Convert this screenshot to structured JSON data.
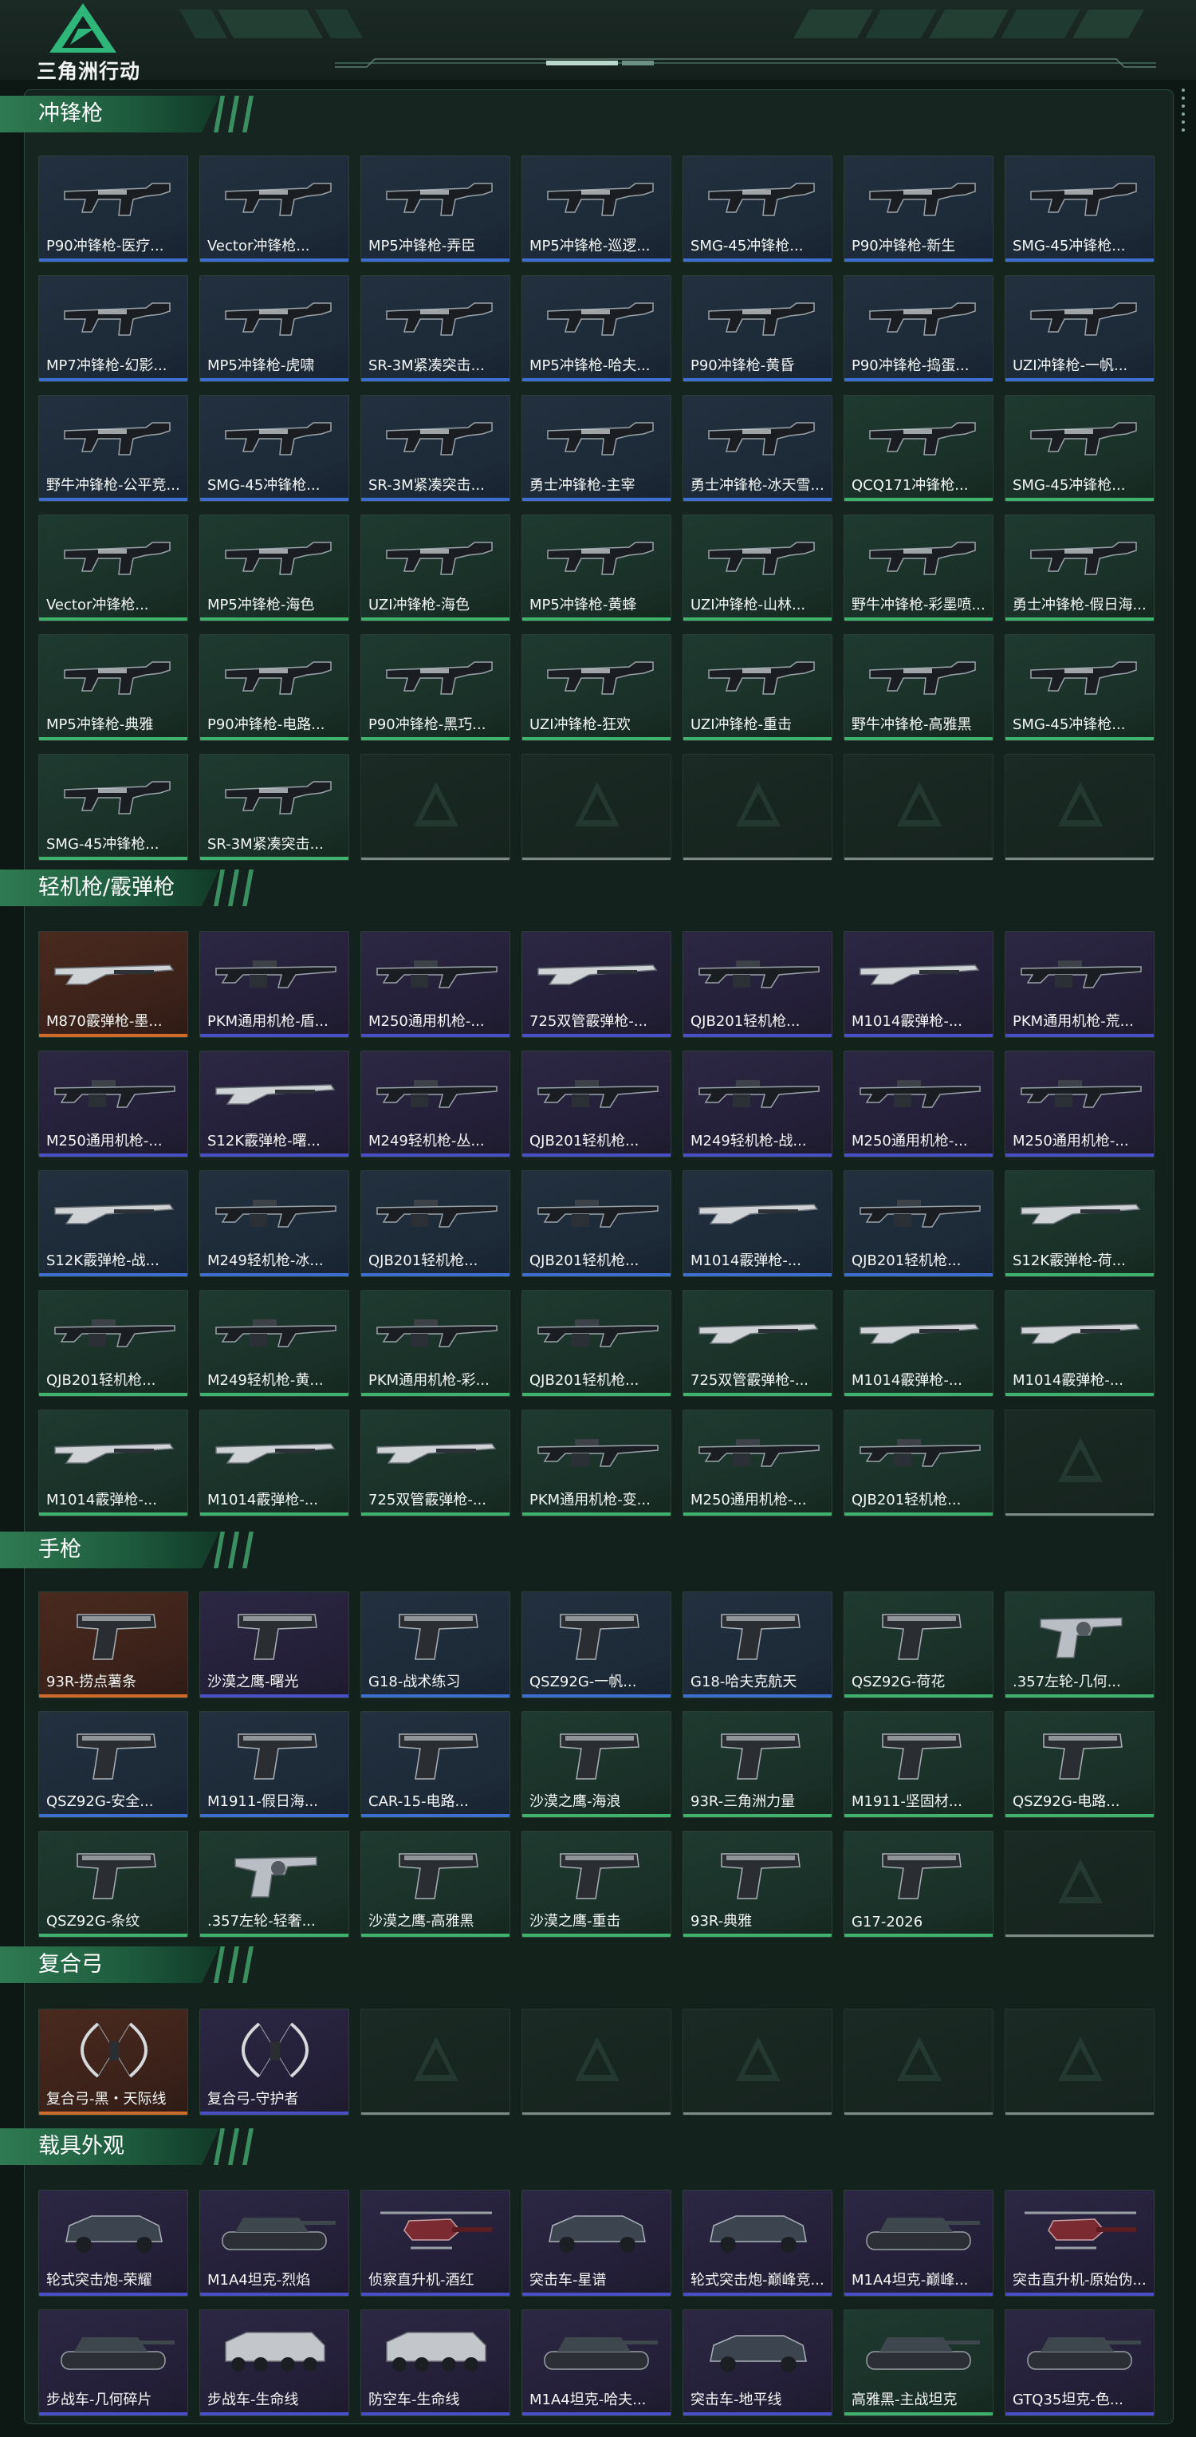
{
  "header": {
    "logo_text": "三角洲行动"
  },
  "colors": {
    "purple": "#4a4fc8",
    "blue": "#3c6fd0",
    "green": "#3fb36e",
    "orange": "#d06a2a",
    "empty": "#7d8a85"
  },
  "sections": [
    {
      "title": "冲锋枪",
      "items": [
        {
          "name": "P90冲锋枪-医疗...",
          "rarity": "blue",
          "icon": "smg-icon"
        },
        {
          "name": "Vector冲锋枪...",
          "rarity": "blue",
          "icon": "smg-icon"
        },
        {
          "name": "MP5冲锋枪-弄臣",
          "rarity": "blue",
          "icon": "smg-icon"
        },
        {
          "name": "MP5冲锋枪-巡逻...",
          "rarity": "blue",
          "icon": "smg-icon"
        },
        {
          "name": "SMG-45冲锋枪...",
          "rarity": "blue",
          "icon": "smg-icon"
        },
        {
          "name": "P90冲锋枪-新生",
          "rarity": "blue",
          "icon": "smg-icon"
        },
        {
          "name": "SMG-45冲锋枪...",
          "rarity": "blue",
          "icon": "smg-icon"
        },
        {
          "name": "MP7冲锋枪-幻影...",
          "rarity": "blue",
          "icon": "smg-icon"
        },
        {
          "name": "MP5冲锋枪-虎啸",
          "rarity": "blue",
          "icon": "smg-icon"
        },
        {
          "name": "SR-3M紧凑突击...",
          "rarity": "blue",
          "icon": "smg-icon"
        },
        {
          "name": "MP5冲锋枪-哈夫...",
          "rarity": "blue",
          "icon": "smg-icon"
        },
        {
          "name": "P90冲锋枪-黄昏",
          "rarity": "blue",
          "icon": "smg-icon"
        },
        {
          "name": "P90冲锋枪-捣蛋...",
          "rarity": "blue",
          "icon": "smg-icon"
        },
        {
          "name": "UZI冲锋枪-一帆...",
          "rarity": "blue",
          "icon": "smg-icon"
        },
        {
          "name": "野牛冲锋枪-公平竞...",
          "rarity": "blue",
          "icon": "smg-icon"
        },
        {
          "name": "SMG-45冲锋枪...",
          "rarity": "blue",
          "icon": "smg-icon"
        },
        {
          "name": "SR-3M紧凑突击...",
          "rarity": "blue",
          "icon": "smg-icon"
        },
        {
          "name": "勇士冲锋枪-主宰",
          "rarity": "blue",
          "icon": "smg-icon"
        },
        {
          "name": "勇士冲锋枪-冰天雪...",
          "rarity": "blue",
          "icon": "smg-icon"
        },
        {
          "name": "QCQ171冲锋枪...",
          "rarity": "green",
          "icon": "smg-icon"
        },
        {
          "name": "SMG-45冲锋枪...",
          "rarity": "green",
          "icon": "smg-icon"
        },
        {
          "name": "Vector冲锋枪...",
          "rarity": "green",
          "icon": "smg-icon"
        },
        {
          "name": "MP5冲锋枪-海色",
          "rarity": "green",
          "icon": "smg-icon"
        },
        {
          "name": "UZI冲锋枪-海色",
          "rarity": "green",
          "icon": "smg-icon"
        },
        {
          "name": "MP5冲锋枪-黄蜂",
          "rarity": "green",
          "icon": "smg-icon"
        },
        {
          "name": "UZI冲锋枪-山林...",
          "rarity": "green",
          "icon": "smg-icon"
        },
        {
          "name": "野牛冲锋枪-彩墨喷...",
          "rarity": "green",
          "icon": "smg-icon"
        },
        {
          "name": "勇士冲锋枪-假日海...",
          "rarity": "green",
          "icon": "smg-icon"
        },
        {
          "name": "MP5冲锋枪-典雅",
          "rarity": "green",
          "icon": "smg-icon"
        },
        {
          "name": "P90冲锋枪-电路...",
          "rarity": "green",
          "icon": "smg-icon"
        },
        {
          "name": "P90冲锋枪-黑巧...",
          "rarity": "green",
          "icon": "smg-icon"
        },
        {
          "name": "UZI冲锋枪-狂欢",
          "rarity": "green",
          "icon": "smg-icon"
        },
        {
          "name": "UZI冲锋枪-重击",
          "rarity": "green",
          "icon": "smg-icon"
        },
        {
          "name": "野牛冲锋枪-高雅黑",
          "rarity": "green",
          "icon": "smg-icon"
        },
        {
          "name": "SMG-45冲锋枪...",
          "rarity": "green",
          "icon": "smg-icon"
        },
        {
          "name": "SMG-45冲锋枪...",
          "rarity": "green",
          "icon": "smg-icon"
        },
        {
          "name": "SR-3M紧凑突击...",
          "rarity": "green",
          "icon": "smg-icon"
        },
        {
          "name": "",
          "rarity": "empty"
        },
        {
          "name": "",
          "rarity": "empty"
        },
        {
          "name": "",
          "rarity": "empty"
        },
        {
          "name": "",
          "rarity": "empty"
        },
        {
          "name": "",
          "rarity": "empty"
        }
      ]
    },
    {
      "title": "轻机枪/霰弹枪",
      "items": [
        {
          "name": "M870霰弹枪-墨...",
          "rarity": "orange",
          "icon": "shotgun-icon"
        },
        {
          "name": "PKM通用机枪-盾...",
          "rarity": "purple",
          "icon": "lmg-icon"
        },
        {
          "name": "M250通用机枪-...",
          "rarity": "purple",
          "icon": "lmg-icon"
        },
        {
          "name": "725双管霰弹枪-...",
          "rarity": "purple",
          "icon": "shotgun-icon"
        },
        {
          "name": "QJB201轻机枪...",
          "rarity": "purple",
          "icon": "lmg-icon"
        },
        {
          "name": "M1014霰弹枪-...",
          "rarity": "purple",
          "icon": "shotgun-icon"
        },
        {
          "name": "PKM通用机枪-荒...",
          "rarity": "purple",
          "icon": "lmg-icon"
        },
        {
          "name": "M250通用机枪-...",
          "rarity": "purple",
          "icon": "lmg-icon"
        },
        {
          "name": "S12K霰弹枪-曙...",
          "rarity": "purple",
          "icon": "shotgun-icon"
        },
        {
          "name": "M249轻机枪-丛...",
          "rarity": "purple",
          "icon": "lmg-icon"
        },
        {
          "name": "QJB201轻机枪...",
          "rarity": "purple",
          "icon": "lmg-icon"
        },
        {
          "name": "M249轻机枪-战...",
          "rarity": "purple",
          "icon": "lmg-icon"
        },
        {
          "name": "M250通用机枪-...",
          "rarity": "purple",
          "icon": "lmg-icon"
        },
        {
          "name": "M250通用机枪-...",
          "rarity": "purple",
          "icon": "lmg-icon"
        },
        {
          "name": "S12K霰弹枪-战...",
          "rarity": "blue",
          "icon": "shotgun-icon"
        },
        {
          "name": "M249轻机枪-冰...",
          "rarity": "blue",
          "icon": "lmg-icon"
        },
        {
          "name": "QJB201轻机枪...",
          "rarity": "blue",
          "icon": "lmg-icon"
        },
        {
          "name": "QJB201轻机枪...",
          "rarity": "blue",
          "icon": "lmg-icon"
        },
        {
          "name": "M1014霰弹枪-...",
          "rarity": "blue",
          "icon": "shotgun-icon"
        },
        {
          "name": "QJB201轻机枪...",
          "rarity": "blue",
          "icon": "lmg-icon"
        },
        {
          "name": "S12K霰弹枪-荷...",
          "rarity": "green",
          "icon": "shotgun-icon"
        },
        {
          "name": "QJB201轻机枪...",
          "rarity": "green",
          "icon": "lmg-icon"
        },
        {
          "name": "M249轻机枪-黄...",
          "rarity": "green",
          "icon": "lmg-icon"
        },
        {
          "name": "PKM通用机枪-彩...",
          "rarity": "green",
          "icon": "lmg-icon"
        },
        {
          "name": "QJB201轻机枪...",
          "rarity": "green",
          "icon": "lmg-icon"
        },
        {
          "name": "725双管霰弹枪-...",
          "rarity": "green",
          "icon": "shotgun-icon"
        },
        {
          "name": "M1014霰弹枪-...",
          "rarity": "green",
          "icon": "shotgun-icon"
        },
        {
          "name": "M1014霰弹枪-...",
          "rarity": "green",
          "icon": "shotgun-icon"
        },
        {
          "name": "M1014霰弹枪-...",
          "rarity": "green",
          "icon": "shotgun-icon"
        },
        {
          "name": "M1014霰弹枪-...",
          "rarity": "green",
          "icon": "shotgun-icon"
        },
        {
          "name": "725双管霰弹枪-...",
          "rarity": "green",
          "icon": "shotgun-icon"
        },
        {
          "name": "PKM通用机枪-变...",
          "rarity": "green",
          "icon": "lmg-icon"
        },
        {
          "name": "M250通用机枪-...",
          "rarity": "green",
          "icon": "lmg-icon"
        },
        {
          "name": "QJB201轻机枪...",
          "rarity": "green",
          "icon": "lmg-icon"
        },
        {
          "name": "",
          "rarity": "empty"
        }
      ]
    },
    {
      "title": "手枪",
      "items": [
        {
          "name": "93R-捞点薯条",
          "rarity": "orange",
          "icon": "pistol-icon"
        },
        {
          "name": "沙漠之鹰-曙光",
          "rarity": "purple",
          "icon": "pistol-icon"
        },
        {
          "name": "G18-战术练习",
          "rarity": "blue",
          "icon": "pistol-icon"
        },
        {
          "name": "QSZ92G-一帆...",
          "rarity": "blue",
          "icon": "pistol-icon"
        },
        {
          "name": "G18-哈夫克航天",
          "rarity": "blue",
          "icon": "pistol-icon"
        },
        {
          "name": "QSZ92G-荷花",
          "rarity": "green",
          "icon": "pistol-icon"
        },
        {
          "name": ".357左轮-几何...",
          "rarity": "green",
          "icon": "revolver-icon"
        },
        {
          "name": "QSZ92G-安全...",
          "rarity": "blue",
          "icon": "pistol-icon"
        },
        {
          "name": "M1911-假日海...",
          "rarity": "blue",
          "icon": "pistol-icon"
        },
        {
          "name": "CAR-15-电路...",
          "rarity": "blue",
          "icon": "pistol-icon"
        },
        {
          "name": "沙漠之鹰-海浪",
          "rarity": "green",
          "icon": "pistol-icon"
        },
        {
          "name": "93R-三角洲力量",
          "rarity": "green",
          "icon": "pistol-icon"
        },
        {
          "name": "M1911-坚固材...",
          "rarity": "green",
          "icon": "pistol-icon"
        },
        {
          "name": "QSZ92G-电路...",
          "rarity": "green",
          "icon": "pistol-icon"
        },
        {
          "name": "QSZ92G-条纹",
          "rarity": "green",
          "icon": "pistol-icon"
        },
        {
          "name": ".357左轮-轻奢...",
          "rarity": "green",
          "icon": "revolver-icon"
        },
        {
          "name": "沙漠之鹰-高雅黑",
          "rarity": "green",
          "icon": "pistol-icon"
        },
        {
          "name": "沙漠之鹰-重击",
          "rarity": "green",
          "icon": "pistol-icon"
        },
        {
          "name": "93R-典雅",
          "rarity": "green",
          "icon": "pistol-icon"
        },
        {
          "name": "G17-2026",
          "rarity": "green",
          "icon": "pistol-icon"
        },
        {
          "name": "",
          "rarity": "empty"
        }
      ]
    },
    {
      "title": "复合弓",
      "items": [
        {
          "name": "复合弓-黑・天际线",
          "rarity": "orange",
          "icon": "bow-icon"
        },
        {
          "name": "复合弓-守护者",
          "rarity": "purple",
          "icon": "bow-icon"
        },
        {
          "name": "",
          "rarity": "empty"
        },
        {
          "name": "",
          "rarity": "empty"
        },
        {
          "name": "",
          "rarity": "empty"
        },
        {
          "name": "",
          "rarity": "empty"
        },
        {
          "name": "",
          "rarity": "empty"
        }
      ]
    },
    {
      "title": "载具外观",
      "items": [
        {
          "name": "轮式突击炮-荣耀",
          "rarity": "purple",
          "icon": "vehicle-icon"
        },
        {
          "name": "M1A4坦克-烈焰",
          "rarity": "purple",
          "icon": "tank-icon"
        },
        {
          "name": "侦察直升机-酒红",
          "rarity": "purple",
          "icon": "helicopter-icon"
        },
        {
          "name": "突击车-星谱",
          "rarity": "purple",
          "icon": "vehicle-icon"
        },
        {
          "name": "轮式突击炮-巅峰竞...",
          "rarity": "purple",
          "icon": "vehicle-icon"
        },
        {
          "name": "M1A4坦克-巅峰...",
          "rarity": "purple",
          "icon": "tank-icon"
        },
        {
          "name": "突击直升机-原始伪...",
          "rarity": "purple",
          "icon": "helicopter-icon"
        },
        {
          "name": "步战车-几何碎片",
          "rarity": "purple",
          "icon": "tank-icon"
        },
        {
          "name": "步战车-生命线",
          "rarity": "purple",
          "icon": "apc-icon"
        },
        {
          "name": "防空车-生命线",
          "rarity": "purple",
          "icon": "apc-icon"
        },
        {
          "name": "M1A4坦克-哈夫...",
          "rarity": "purple",
          "icon": "tank-icon"
        },
        {
          "name": "突击车-地平线",
          "rarity": "purple",
          "icon": "vehicle-icon"
        },
        {
          "name": "高雅黑-主战坦克",
          "rarity": "green",
          "icon": "tank-icon"
        },
        {
          "name": "GTQ35坦克-色...",
          "rarity": "purple",
          "icon": "tank-icon"
        }
      ]
    }
  ]
}
